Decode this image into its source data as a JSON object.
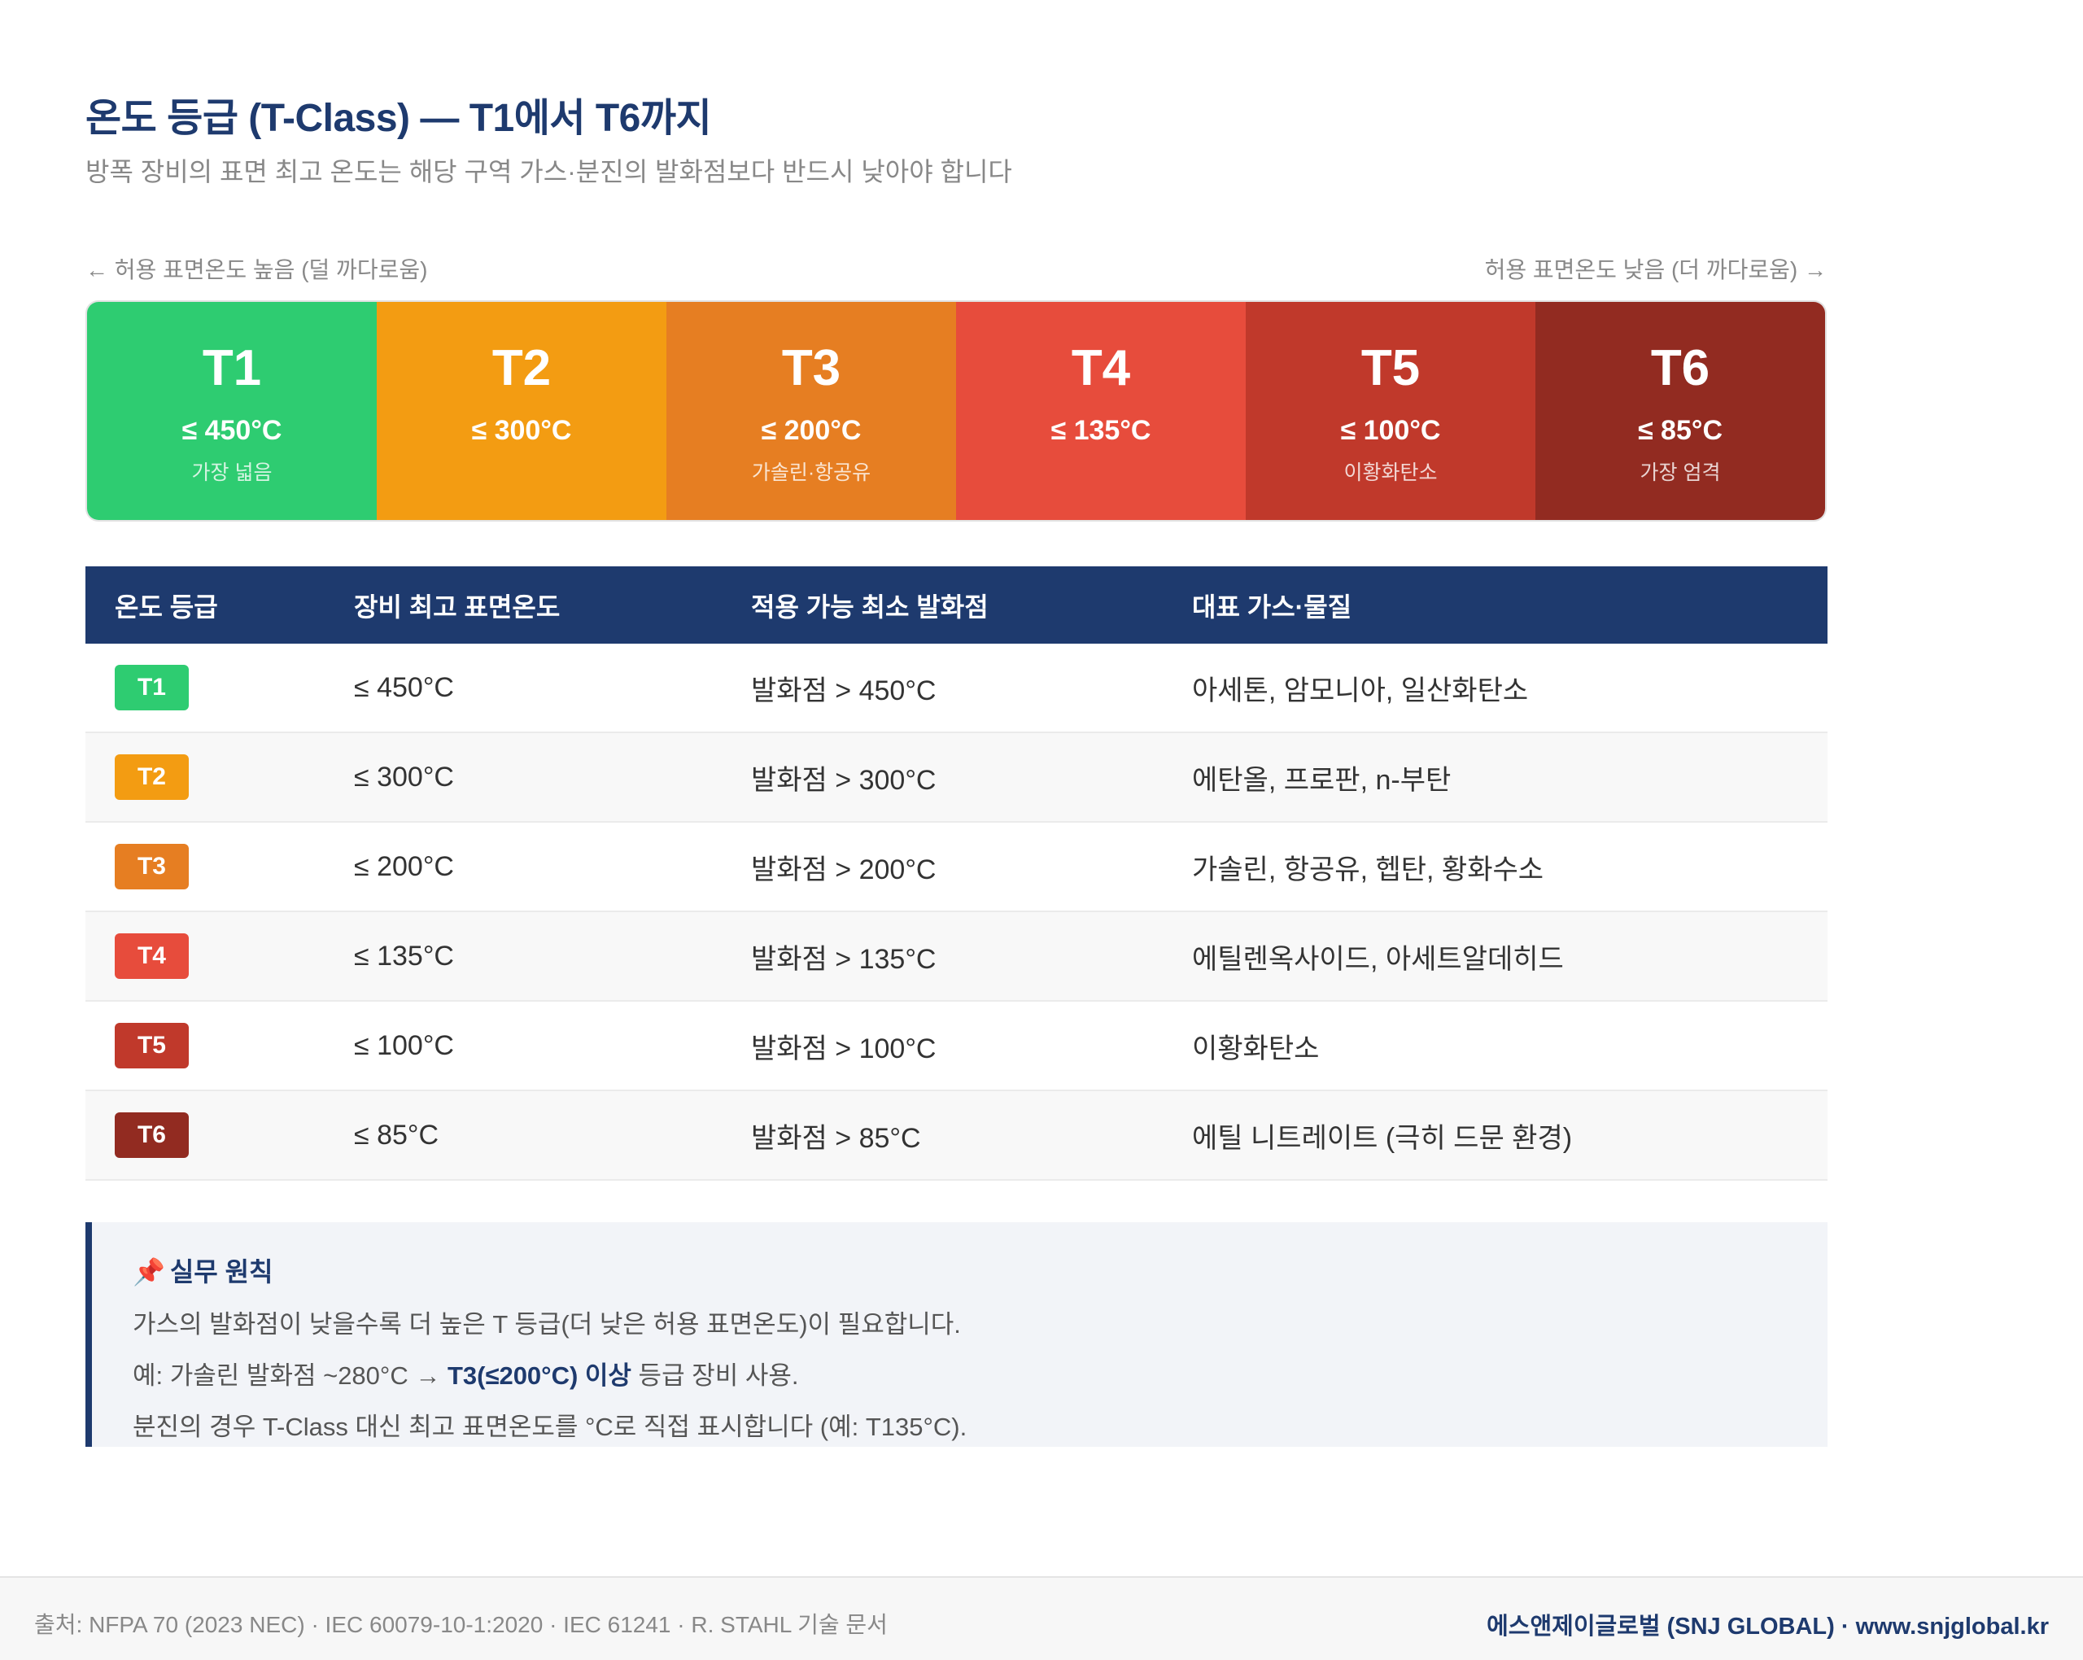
{
  "header": {
    "title": "온도 등급 (T-Class) — T1에서 T6까지",
    "subtitle": "방폭 장비의 표면 최고 온도는 해당 구역 가스·분진의 발화점보다 반드시 낮아야 합니다"
  },
  "scale": {
    "left_label": "← 허용 표면온도 높음 (덜 까다로움)",
    "right_label": "허용 표면온도 낮음 (더 까다로움) →",
    "bands": [
      {
        "cls": "T1",
        "temp": "≤ 450°C",
        "note": "가장 넓음",
        "color": "#2ecc71"
      },
      {
        "cls": "T2",
        "temp": "≤ 300°C",
        "note": "",
        "color": "#f39c12"
      },
      {
        "cls": "T3",
        "temp": "≤ 200°C",
        "note": "가솔린·항공유",
        "color": "#e67e22"
      },
      {
        "cls": "T4",
        "temp": "≤ 135°C",
        "note": "",
        "color": "#e74c3c"
      },
      {
        "cls": "T5",
        "temp": "≤ 100°C",
        "note": "이황화탄소",
        "color": "#c0392b"
      },
      {
        "cls": "T6",
        "temp": "≤ 85°C",
        "note": "가장 엄격",
        "color": "#922b21"
      }
    ]
  },
  "table": {
    "headers": [
      "온도 등급",
      "장비 최고 표면온도",
      "적용 가능 최소 발화점",
      "대표 가스·물질"
    ],
    "rows": [
      {
        "cls": "T1",
        "max": "≤ 450°C",
        "ignition": "발화점 > 450°C",
        "gases": "아세톤, 암모니아, 일산화탄소",
        "color": "#2ecc71"
      },
      {
        "cls": "T2",
        "max": "≤ 300°C",
        "ignition": "발화점 > 300°C",
        "gases": "에탄올, 프로판, n-부탄",
        "color": "#f39c12"
      },
      {
        "cls": "T3",
        "max": "≤ 200°C",
        "ignition": "발화점 > 200°C",
        "gases": "가솔린, 항공유, 헵탄, 황화수소",
        "color": "#e67e22"
      },
      {
        "cls": "T4",
        "max": "≤ 135°C",
        "ignition": "발화점 > 135°C",
        "gases": "에틸렌옥사이드, 아세트알데히드",
        "color": "#e74c3c"
      },
      {
        "cls": "T5",
        "max": "≤ 100°C",
        "ignition": "발화점 > 100°C",
        "gases": "이황화탄소",
        "color": "#c0392b"
      },
      {
        "cls": "T6",
        "max": "≤ 85°C",
        "ignition": "발화점 > 85°C",
        "gases": "에틸 니트레이트 (극히 드문 환경)",
        "color": "#922b21"
      }
    ]
  },
  "note": {
    "icon": "pushpin-icon",
    "heading": "실무 원칙",
    "line1": "가스의 발화점이 낮을수록 더 높은 T 등급(더 낮은 허용 표면온도)이 필요합니다.",
    "line2_pre": "예: 가솔린 발화점 ~280°C → ",
    "line2_bold": "T3(≤200°C) 이상",
    "line2_post": " 등급 장비 사용.",
    "line3": "분진의 경우 T-Class 대신 최고 표면온도를 °C로 직접 표시합니다 (예: T135°C)."
  },
  "footer": {
    "source": "출처: NFPA 70 (2023 NEC) · IEC 60079-10-1:2020 · IEC 61241 · R. STAHL 기술 문서",
    "brand": "에스앤제이글로벌 (SNJ GLOBAL) · www.snjglobal.kr"
  }
}
